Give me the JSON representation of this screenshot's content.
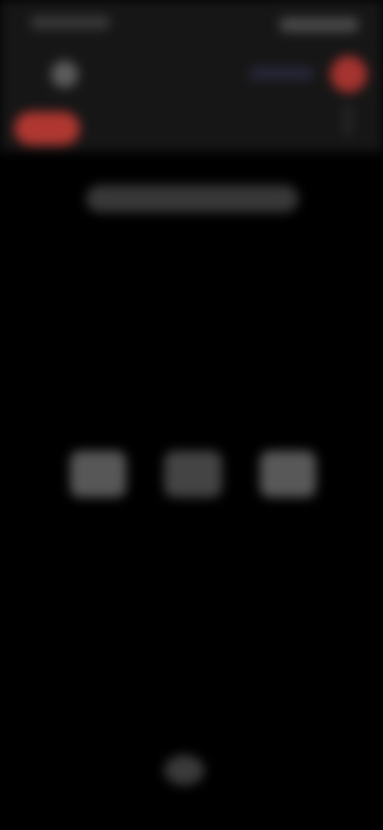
{
  "status_bar": {
    "time": "",
    "icons": ""
  },
  "header": {
    "back_icon": "back-icon",
    "title": "",
    "record_icon": "record-icon",
    "accent_color": "#b03731"
  },
  "control": {
    "red_pill_label": ""
  },
  "hint": {
    "text": ""
  },
  "modes": [
    {
      "label": ""
    },
    {
      "label": ""
    },
    {
      "label": ""
    }
  ],
  "navigation": {
    "home_icon": "home-indicator-icon"
  }
}
